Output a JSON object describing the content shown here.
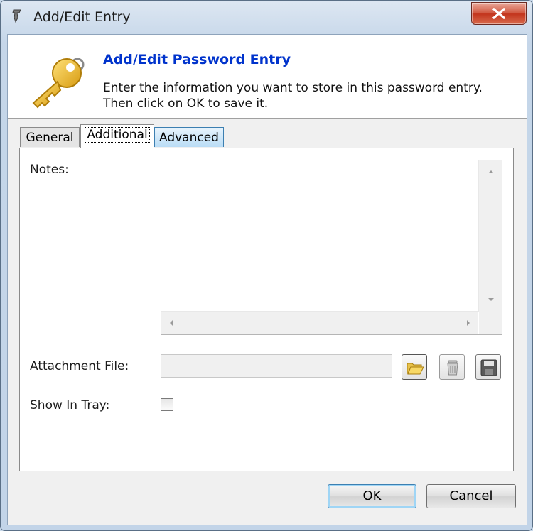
{
  "window": {
    "title": "Add/Edit Entry",
    "close_label": "Close"
  },
  "header": {
    "title": "Add/Edit Password Entry",
    "description_line1": "Enter the information you want to store in this password entry.",
    "description_line2": "Then click on OK to save it."
  },
  "tabs": [
    {
      "label": "General",
      "selected": false
    },
    {
      "label": "Additional",
      "selected": true
    },
    {
      "label": "Advanced",
      "selected": false
    }
  ],
  "additional": {
    "notes_label": "Notes:",
    "notes_value": "",
    "attachment_label": "Attachment File:",
    "attachment_value": "",
    "show_in_tray_label": "Show In Tray:",
    "show_in_tray_checked": false,
    "icons": [
      "open-folder-icon",
      "trash-icon",
      "save-disk-icon"
    ]
  },
  "buttons": {
    "ok": "OK",
    "cancel": "Cancel"
  }
}
